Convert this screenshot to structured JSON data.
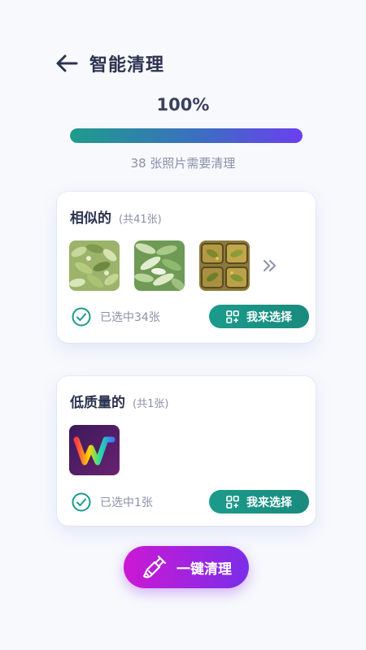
{
  "header": {
    "title": "智能清理",
    "back_icon": "back-arrow-icon"
  },
  "progress": {
    "percent_label": "100%",
    "fraction": 1.0,
    "caption": "38 张照片需要清理"
  },
  "cards": [
    {
      "title": "相似的",
      "count": "(共41张)",
      "thumbnails": [
        "green-beans-photo-1",
        "green-beans-photo-2",
        "okra-tray-photo"
      ],
      "more_icon": "double-chevron-right-icon",
      "selected": "已选中34张",
      "action": "我来选择"
    },
    {
      "title": "低质量的",
      "count": "(共1张)",
      "thumbnails": [
        "app-logo-w-photo"
      ],
      "selected": "已选中1张",
      "action": "我来选择"
    }
  ],
  "footer": {
    "clean_label": "一键清理",
    "icon": "broom-icon"
  },
  "colors": {
    "accent_teal": "#1b9b8b",
    "progress_start": "#1f9c8c",
    "progress_end": "#6b3ff0",
    "clean_btn_start": "#cc18d4",
    "clean_btn_end": "#7a2ee8",
    "title_text": "#2c3350",
    "muted_text": "#8a91a8"
  }
}
